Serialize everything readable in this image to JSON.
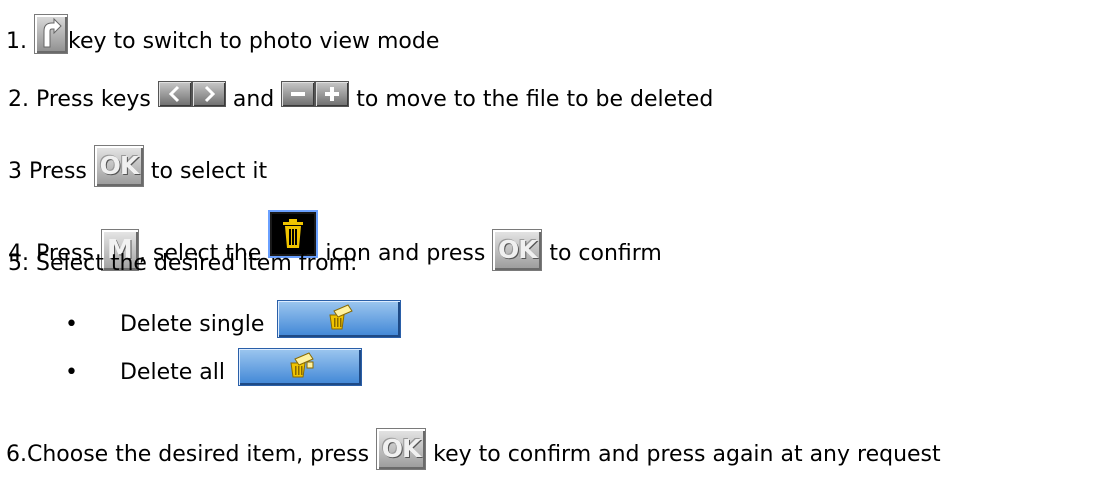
{
  "steps": {
    "s1": {
      "num": "1.",
      "text": "key to switch to photo view mode"
    },
    "s2": {
      "pre": "2. Press keys",
      "mid": "and",
      "post": "to move to the file to be deleted"
    },
    "s3": {
      "pre": "3 Press",
      "post": "to select it"
    },
    "s4": {
      "pre": "4. Press",
      "mid1": ", select the",
      "mid2": "icon and press",
      "post": "to confirm"
    },
    "s5": {
      "text": "5. Select the desired item from:"
    },
    "s6": {
      "pre": "6.Choose the desired item, press",
      "post": "key to confirm and press again at any request"
    }
  },
  "options": [
    {
      "label": "Delete single",
      "icon": "delete-single-icon"
    },
    {
      "label": "Delete all",
      "icon": "delete-all-icon"
    }
  ],
  "keys": {
    "ok": "OK",
    "menu": "M"
  },
  "colors": {
    "key_grey": "#a0a0a0",
    "trash_yellow": "#f0c400",
    "option_blue": "#4a8fd9"
  }
}
